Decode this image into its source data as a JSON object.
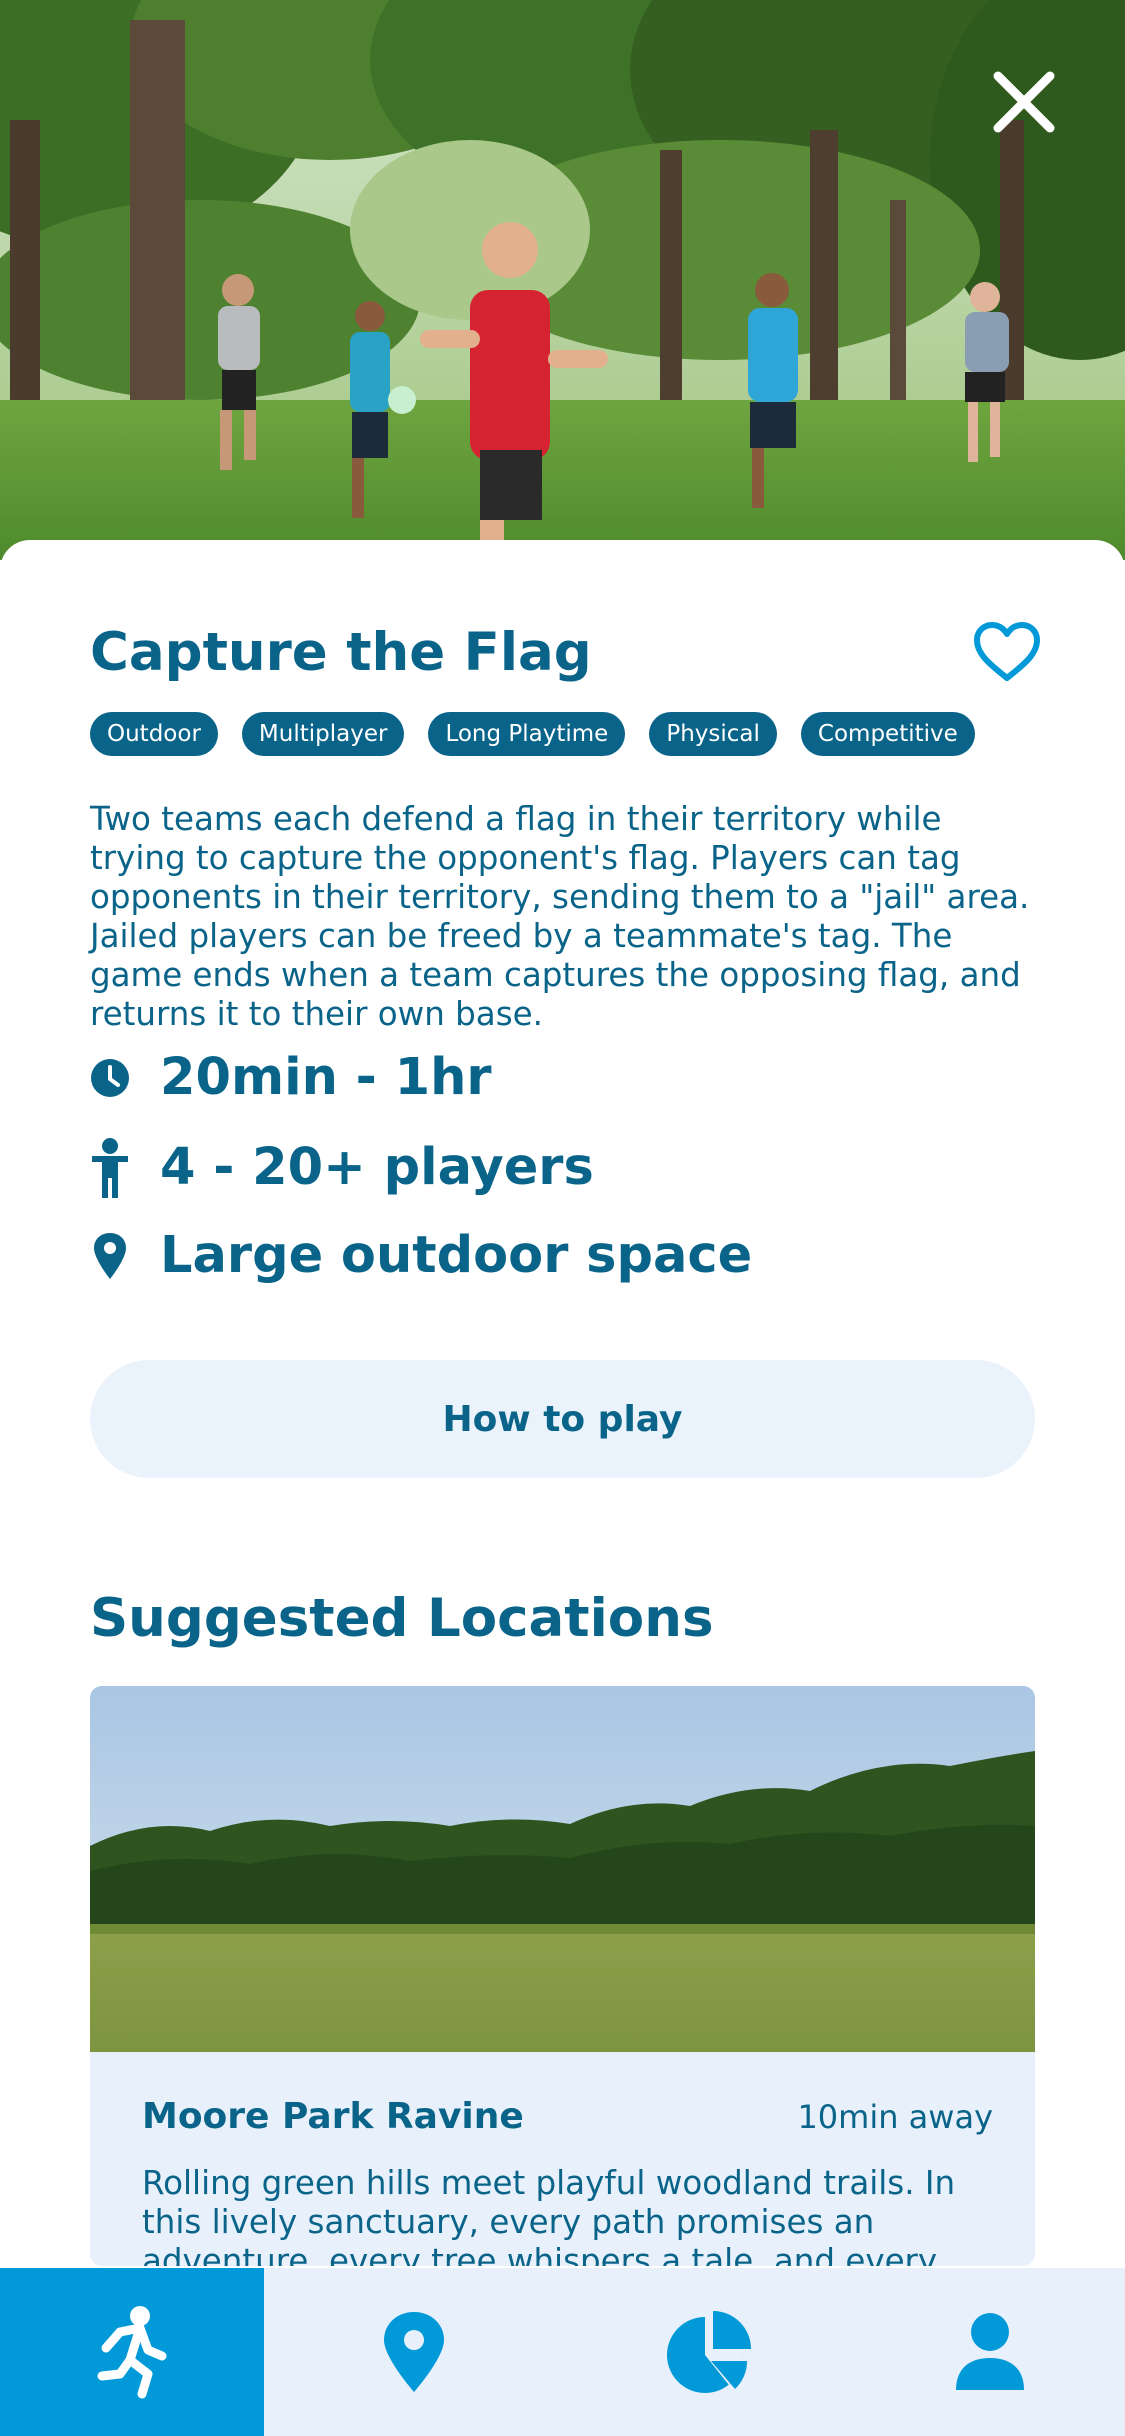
{
  "activity": {
    "title": "Capture the Flag",
    "tags": [
      "Outdoor",
      "Multiplayer",
      "Long Playtime",
      "Physical",
      "Competitive"
    ],
    "description": "Two teams each defend a flag in their territory while trying to capture the opponent's flag. Players can tag opponents in their territory, sending them to a \"jail\" area. Jailed players can be freed by a teammate's tag. The game ends when a team captures the opposing flag, and returns it to their own base.",
    "duration": "20min - 1hr",
    "players": "4 - 20+ players",
    "space": "Large outdoor space",
    "how_to_play_label": "How to play",
    "favorited": false
  },
  "suggested": {
    "title": "Suggested Locations",
    "locations": [
      {
        "name": "Moore Park Ravine",
        "distance": "10min away",
        "description": "Rolling green hills meet playful woodland trails. In this lively sanctuary, every path promises an adventure, every tree whispers a tale, and every visit ignites"
      }
    ]
  },
  "icons": {
    "close": "close-icon",
    "favorite": "heart-outline-icon",
    "duration": "clock-icon",
    "players": "person-icon",
    "space": "map-pin-icon",
    "nav_activities": "running-person-icon",
    "nav_locations": "map-pin-icon",
    "nav_stats": "pie-chart-icon",
    "nav_profile": "user-icon"
  },
  "nav": {
    "active": "activities"
  },
  "colors": {
    "primary": "#0a6489",
    "accent": "#0199d8",
    "surface": "#eaf3fc"
  }
}
